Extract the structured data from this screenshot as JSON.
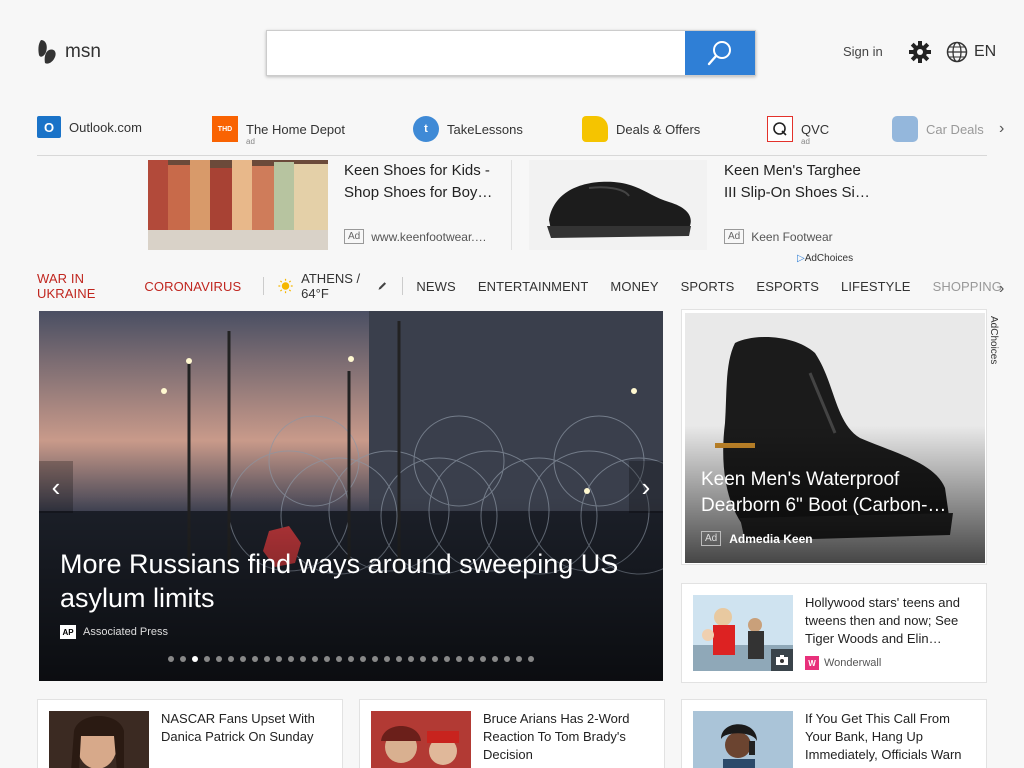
{
  "header": {
    "logo_text": "msn",
    "search": {
      "value": "",
      "placeholder": ""
    },
    "sign_in": "Sign in",
    "language": "EN"
  },
  "quick_links": [
    {
      "label": "Outlook.com",
      "ad": ""
    },
    {
      "label": "The Home Depot",
      "ad": "ad"
    },
    {
      "label": "TakeLessons",
      "ad": ""
    },
    {
      "label": "Deals & Offers",
      "ad": ""
    },
    {
      "label": "QVC",
      "ad": "ad"
    },
    {
      "label": "Car Deals",
      "ad": ""
    }
  ],
  "ads": [
    {
      "title_line1": "Keen Shoes for Kids -",
      "title_line2": "Shop Shoes for Boy…",
      "badge": "Ad",
      "source": "www.keenfootwear.…"
    },
    {
      "title_line1": "Keen Men's Targhee",
      "title_line2": "III Slip-On Shoes Si…",
      "badge": "Ad",
      "source": "Keen Footwear"
    }
  ],
  "adchoices": "AdChoices",
  "nav": {
    "red_items": [
      "WAR IN UKRAINE",
      "CORONAVIRUS"
    ],
    "weather": "ATHENS / 64°F",
    "items": [
      "NEWS",
      "ENTERTAINMENT",
      "MONEY",
      "SPORTS",
      "ESPORTS",
      "LIFESTYLE"
    ],
    "faded_item": "SHOPPING"
  },
  "hero": {
    "title": "More Russians find ways around sweeping US asylum limits",
    "source_logo": "AP",
    "source": "Associated Press",
    "slide_count": 31,
    "active_slide": 3
  },
  "boot_ad": {
    "title": "Keen Men's Waterproof Dearborn 6\" Boot (Carbon-…",
    "badge": "Ad",
    "source": "Admedia Keen",
    "side_label": "AdChoices"
  },
  "news": [
    {
      "title": "Hollywood stars' teens and tweens then and now; See Tiger Woods and Elin…",
      "source": "Wonderwall",
      "logo": "W"
    },
    {
      "title": "NASCAR Fans Upset With Danica Patrick On Sunday",
      "source": "",
      "logo": ""
    },
    {
      "title": "Bruce Arians Has 2-Word Reaction To Tom Brady's Decision",
      "source": "",
      "logo": ""
    },
    {
      "title": "If You Get This Call From Your Bank, Hang Up Immediately, Officials Warn",
      "source": "",
      "logo": ""
    }
  ],
  "colors": {
    "accent": "#2f7fd6",
    "red": "#c0261f"
  }
}
